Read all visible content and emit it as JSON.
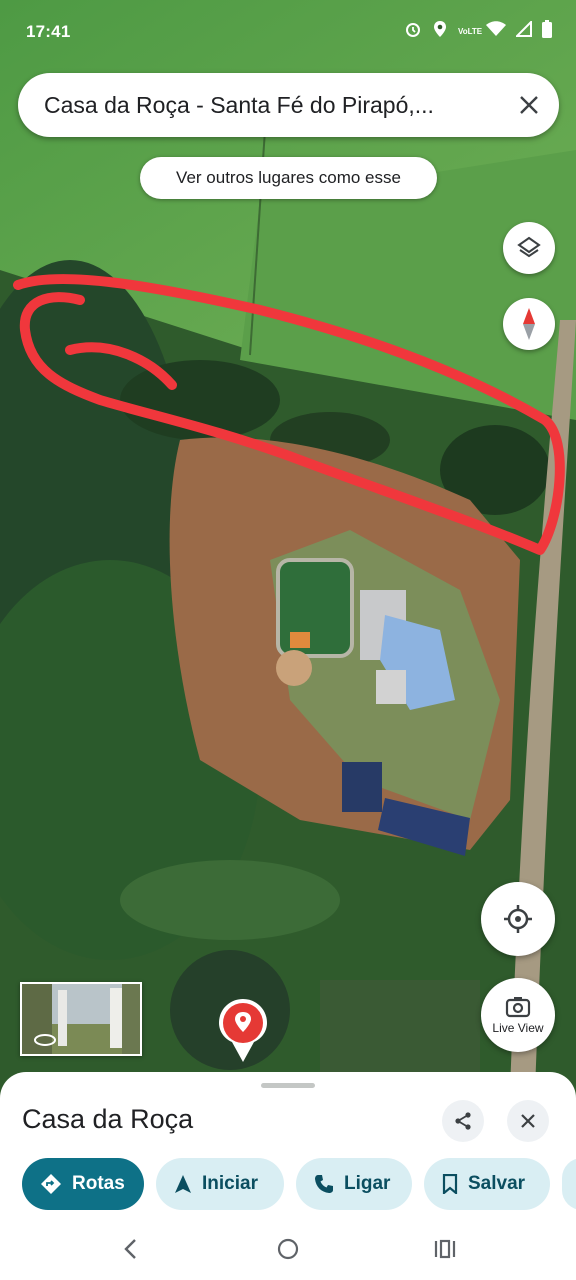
{
  "status_bar": {
    "time": "17:41",
    "network_label": "VoLTE"
  },
  "search": {
    "query": "Casa da Roça - Santa Fé do Pirapó,..."
  },
  "similar_places": {
    "label": "Ver outros lugares como esse"
  },
  "live_view": {
    "label": "Live View"
  },
  "place": {
    "name": "Casa da Roça"
  },
  "actions": [
    {
      "label": "Rotas",
      "icon": "directions-icon"
    },
    {
      "label": "Iniciar",
      "icon": "navigation-arrow-icon"
    },
    {
      "label": "Ligar",
      "icon": "phone-icon"
    },
    {
      "label": "Salvar",
      "icon": "bookmark-icon"
    }
  ],
  "colors": {
    "accent": "#0e7187",
    "chip_bg": "#d9eef3",
    "marker": "#e53935",
    "annotation": "#f0373c"
  }
}
